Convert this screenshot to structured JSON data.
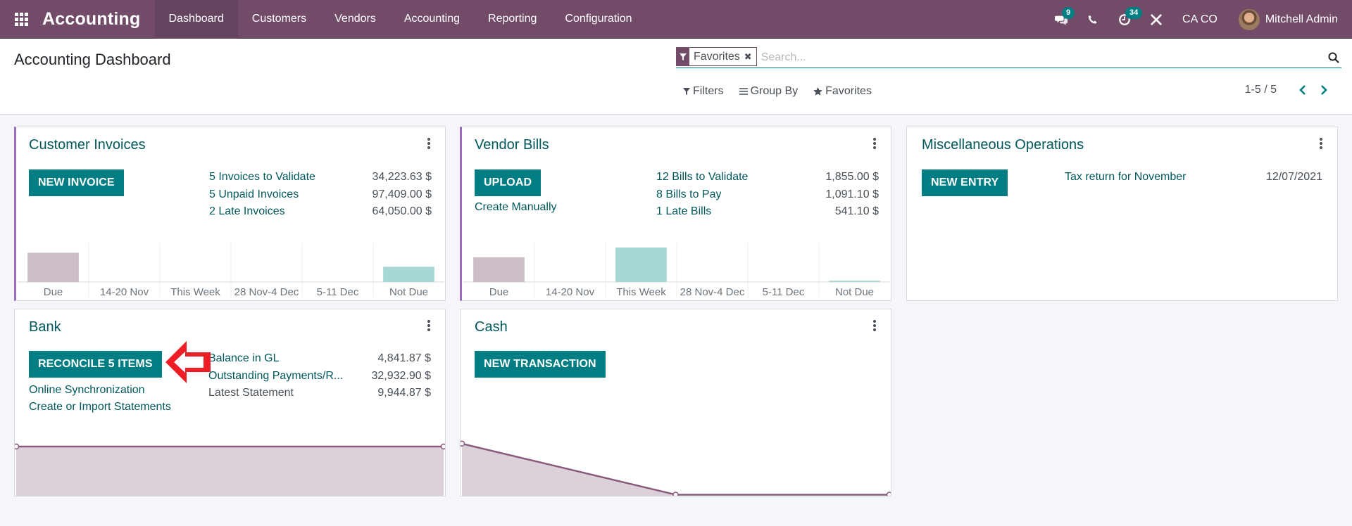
{
  "navbar": {
    "app_name": "Accounting",
    "menu": [
      {
        "label": "Dashboard",
        "active": true
      },
      {
        "label": "Customers",
        "active": false
      },
      {
        "label": "Vendors",
        "active": false
      },
      {
        "label": "Accounting",
        "active": false
      },
      {
        "label": "Reporting",
        "active": false
      },
      {
        "label": "Configuration",
        "active": false
      }
    ],
    "messages_count": "9",
    "activities_count": "34",
    "company": "CA CO",
    "user_name": "Mitchell Admin",
    "icons": [
      "apps-grid-icon",
      "chat-icon",
      "phone-icon",
      "clock-icon",
      "tools-icon"
    ]
  },
  "control_panel": {
    "title": "Accounting Dashboard",
    "search": {
      "facet_label": "Favorites",
      "placeholder": "Search..."
    },
    "filters_label": "Filters",
    "groupby_label": "Group By",
    "favorites_label": "Favorites",
    "pager": "1-5 / 5"
  },
  "colors": {
    "brand": "#714B67",
    "accent": "#017e84",
    "link": "#01585c",
    "past_bar": "#cdbec9",
    "future_bar": "#a8d8d6",
    "line_fill": "#dcd1d9",
    "line_stroke": "#875a7b",
    "annotation_arrow": "#ee1c25"
  },
  "cards": {
    "customer_invoices": {
      "title": "Customer Invoices",
      "button": "NEW INVOICE",
      "stats": [
        {
          "label": "5 Invoices to Validate",
          "value": "34,223.63 $"
        },
        {
          "label": "5 Unpaid Invoices",
          "value": "97,409.00 $"
        },
        {
          "label": "2 Late Invoices",
          "value": "64,050.00 $"
        }
      ]
    },
    "vendor_bills": {
      "title": "Vendor Bills",
      "button": "UPLOAD",
      "secondary_link": "Create Manually",
      "stats": [
        {
          "label": "12 Bills to Validate",
          "value": "1,855.00 $"
        },
        {
          "label": "8 Bills to Pay",
          "value": "1,091.10 $"
        },
        {
          "label": "1 Late Bills",
          "value": "541.10 $"
        }
      ]
    },
    "misc_operations": {
      "title": "Miscellaneous Operations",
      "button": "NEW ENTRY",
      "entry_label": "Tax return for November",
      "entry_date": "12/07/2021"
    },
    "bank": {
      "title": "Bank",
      "button": "RECONCILE 5 ITEMS",
      "links": [
        "Online Synchronization",
        "Create or Import Statements"
      ],
      "stats": [
        {
          "label": "Balance in GL",
          "value": "4,841.87 $"
        },
        {
          "label": "Outstanding Payments/R...",
          "value": "32,932.90 $"
        },
        {
          "label": "Latest Statement",
          "value": "9,944.87 $"
        }
      ]
    },
    "cash": {
      "title": "Cash",
      "button": "NEW TRANSACTION"
    }
  },
  "chart_data": [
    {
      "id": "customer_invoices",
      "type": "bar",
      "title": "",
      "categories": [
        "Due",
        "14-20 Nov",
        "This Week",
        "28 Nov-4 Dec",
        "5-11 Dec",
        "Not Due"
      ],
      "values": [
        64050,
        0,
        0,
        0,
        0,
        33359
      ],
      "kinds": [
        "past",
        "future",
        "future",
        "future",
        "future",
        "future"
      ],
      "ylim": [
        0,
        80000
      ],
      "grid": true
    },
    {
      "id": "vendor_bills",
      "type": "bar",
      "title": "",
      "categories": [
        "Due",
        "14-20 Nov",
        "This Week",
        "28 Nov-4 Dec",
        "5-11 Dec",
        "Not Due"
      ],
      "values": [
        541.1,
        0,
        755,
        0,
        0,
        28
      ],
      "kinds": [
        "past",
        "future",
        "future",
        "future",
        "future",
        "future"
      ],
      "ylim": [
        0,
        800
      ],
      "grid": true
    },
    {
      "id": "bank",
      "type": "area",
      "title": "",
      "x": [
        0,
        1,
        2,
        3,
        4,
        5,
        6,
        7,
        8,
        9,
        10,
        11,
        12,
        13,
        14,
        15,
        16,
        17,
        18,
        19,
        20,
        21,
        22,
        23,
        24,
        25,
        26,
        27,
        28,
        29,
        30
      ],
      "values": [
        4841.87,
        4841.87,
        4841.87,
        4841.87,
        4841.87,
        4841.87,
        4841.87,
        4841.87,
        4841.87,
        4841.87,
        4841.87,
        4841.87,
        4841.87,
        4841.87,
        4841.87,
        4841.87,
        4841.87,
        4841.87,
        4841.87,
        4841.87,
        4841.87,
        4841.87,
        4841.87,
        4841.87,
        4841.87,
        4841.87,
        4841.87,
        4841.87,
        4841.87,
        4841.87,
        4841.87
      ],
      "markers": [
        0,
        30
      ],
      "ylim": [
        0,
        8300
      ]
    },
    {
      "id": "cash",
      "type": "area",
      "title": "",
      "x": [
        0,
        1,
        2
      ],
      "values": [
        100,
        0,
        0
      ],
      "markers": [
        0,
        1,
        2
      ],
      "ylim": [
        0,
        135
      ]
    }
  ]
}
